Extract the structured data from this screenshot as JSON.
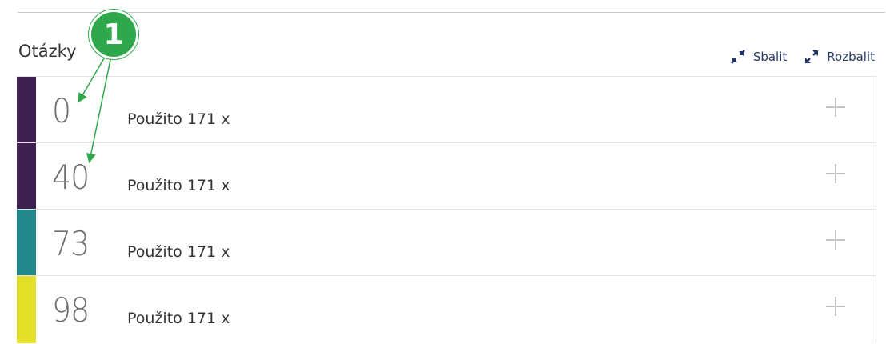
{
  "section": {
    "title": "Otázky"
  },
  "toolbar": {
    "collapse_label": "Sbalit",
    "expand_label": "Rozbalit"
  },
  "rows": [
    {
      "score": "0",
      "usage": "Použito 171 x",
      "color": "#3e2152"
    },
    {
      "score": "40",
      "usage": "Použito 171 x",
      "color": "#3e2152"
    },
    {
      "score": "73",
      "usage": "Použito 171 x",
      "color": "#21898e"
    },
    {
      "score": "98",
      "usage": "Použito 171 x",
      "color": "#e2e128"
    }
  ],
  "annotation": {
    "badge_number": "1",
    "color": "#2ea84a"
  },
  "icons": {
    "collapse": "collapse-arrows-icon",
    "expand": "expand-arrows-icon",
    "row_expand": "plus-icon"
  }
}
